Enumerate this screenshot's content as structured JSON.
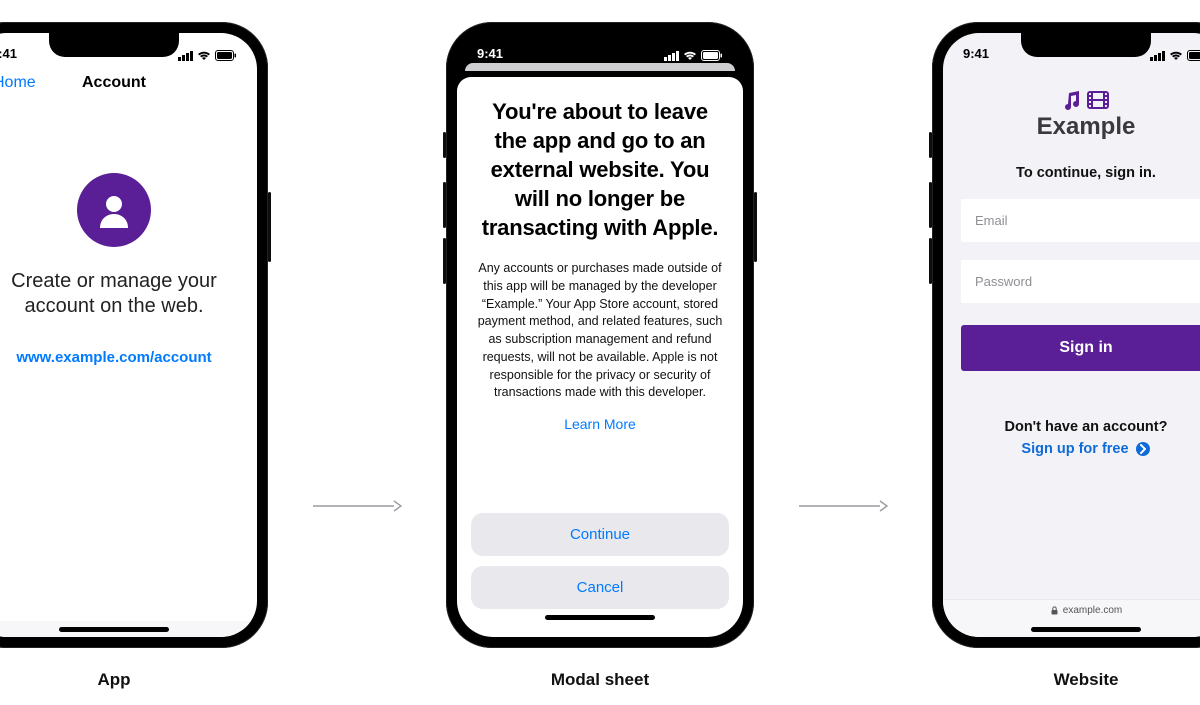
{
  "status": {
    "time": "9:41"
  },
  "captions": {
    "app": "App",
    "modal": "Modal sheet",
    "website": "Website"
  },
  "screen1": {
    "nav_back": "Home",
    "nav_title": "Account",
    "body_text": "Create or manage your account on the web.",
    "link": "www.example.com/account"
  },
  "screen2": {
    "headline": "You're about to leave the app and go to an external website. You will no longer be transacting with Apple.",
    "body": "Any accounts or purchases made outside of this app will be managed by the developer “Example.” Your App Store account, stored payment method, and related features, such as subscription management and refund requests, will not be available. Apple is not responsible for the privacy or security of transactions made with this developer.",
    "learn_more": "Learn More",
    "continue": "Continue",
    "cancel": "Cancel"
  },
  "screen3": {
    "brand": "Example",
    "subtitle": "To continue, sign in.",
    "email_placeholder": "Email",
    "password_placeholder": "Password",
    "signin": "Sign in",
    "no_account": "Don't have an account?",
    "signup": "Sign up for free",
    "url": "example.com"
  }
}
